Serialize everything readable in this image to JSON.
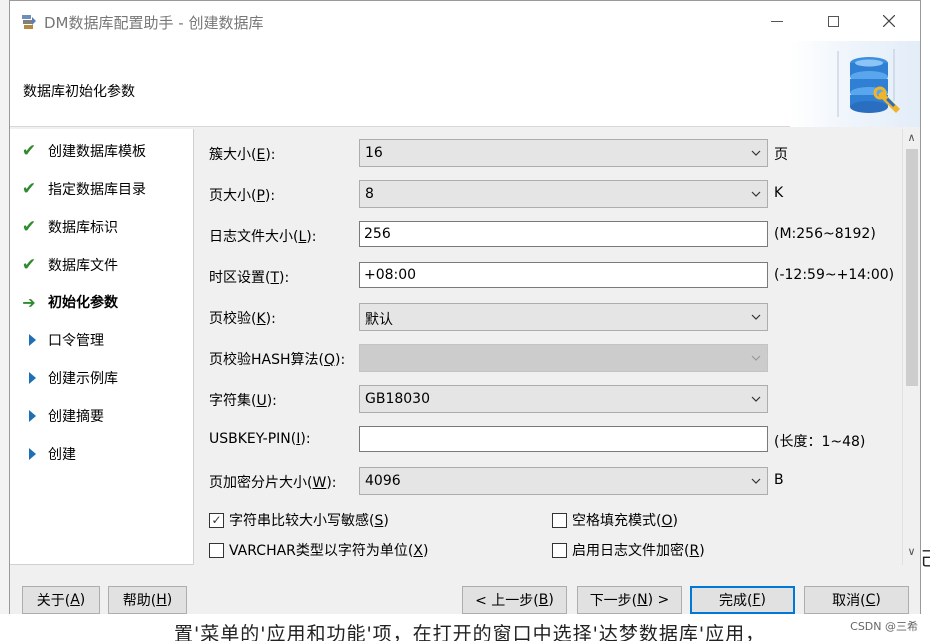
{
  "window": {
    "title": "DM数据库配置助手 - 创建数据库"
  },
  "header": {
    "title": "数据库初始化参数",
    "graphic_icon": "database-config-icon"
  },
  "sidebar": {
    "items": [
      {
        "label": "创建数据库模板",
        "status": "done",
        "icon": "checkmark-icon"
      },
      {
        "label": "指定数据库目录",
        "status": "done",
        "icon": "checkmark-icon"
      },
      {
        "label": "数据库标识",
        "status": "done",
        "icon": "checkmark-icon"
      },
      {
        "label": "数据库文件",
        "status": "done",
        "icon": "checkmark-icon"
      },
      {
        "label": "初始化参数",
        "status": "current",
        "icon": "arrow-right-icon"
      },
      {
        "label": "口令管理",
        "status": "pending",
        "icon": "triangle-right-icon"
      },
      {
        "label": "创建示例库",
        "status": "pending",
        "icon": "triangle-right-icon"
      },
      {
        "label": "创建摘要",
        "status": "pending",
        "icon": "triangle-right-icon"
      },
      {
        "label": "创建",
        "status": "pending",
        "icon": "triangle-right-icon"
      }
    ]
  },
  "form": {
    "extent_size": {
      "label": "簇大小(E):",
      "mnemonic_pre": "簇大小(",
      "mnemonic": "E",
      "mnemonic_post": "):",
      "value": "16",
      "suffix": "页"
    },
    "page_size": {
      "label": "页大小(P):",
      "mnemonic_pre": "页大小(",
      "mnemonic": "P",
      "mnemonic_post": "):",
      "value": "8",
      "suffix": "K"
    },
    "log_size": {
      "label": "日志文件大小(L):",
      "mnemonic_pre": "日志文件大小(",
      "mnemonic": "L",
      "mnemonic_post": "):",
      "value": "256",
      "suffix": "(M:256~8192)"
    },
    "time_zone": {
      "label": "时区设置(T):",
      "mnemonic_pre": "时区设置(",
      "mnemonic": "T",
      "mnemonic_post": "):",
      "value": "+08:00",
      "suffix": "(-12:59~+14:00)"
    },
    "page_check": {
      "label": "页校验(K):",
      "mnemonic_pre": "页校验(",
      "mnemonic": "K",
      "mnemonic_post": "):",
      "value": "默认"
    },
    "page_check_hash": {
      "label": "页校验HASH算法(Q):",
      "mnemonic_pre": "页校验HASH算法(",
      "mnemonic": "Q",
      "mnemonic_post": "):",
      "value": ""
    },
    "charset": {
      "label": "字符集(U):",
      "mnemonic_pre": "字符集(",
      "mnemonic": "U",
      "mnemonic_post": "):",
      "value": "GB18030"
    },
    "usbkey_pin": {
      "label": "USBKEY-PIN(I):",
      "mnemonic_pre": "USBKEY-PIN(",
      "mnemonic": "I",
      "mnemonic_post": "):",
      "value": "",
      "suffix": "(长度：1~48)"
    },
    "page_encrypt": {
      "label": "页加密分片大小(W):",
      "mnemonic_pre": "页加密分片大小(",
      "mnemonic": "W",
      "mnemonic_post": "):",
      "value": "4096",
      "suffix": "B"
    },
    "checks": {
      "case_sensitive": {
        "pre": "字符串比较大小写敏感(",
        "mnemonic": "S",
        "post": ")",
        "checked": true
      },
      "blank_pad": {
        "pre": "空格填充模式(",
        "mnemonic": "O",
        "post": ")",
        "checked": false
      },
      "varchar_char": {
        "pre": "VARCHAR类型以字符为单位(",
        "mnemonic": "X",
        "post": ")",
        "checked": false
      },
      "log_encrypt": {
        "pre": "启用日志文件加密(",
        "mnemonic": "R",
        "post": ")",
        "checked": false
      }
    }
  },
  "footer": {
    "about": {
      "pre": "关于(",
      "mnemonic": "A",
      "post": ")"
    },
    "help": {
      "pre": "帮助(",
      "mnemonic": "H",
      "post": ")"
    },
    "prev": {
      "pre": "< 上一步(",
      "mnemonic": "B",
      "post": ")"
    },
    "next": {
      "pre": "下一步(",
      "mnemonic": "N",
      "post": ") >"
    },
    "finish": {
      "pre": "完成(",
      "mnemonic": "F",
      "post": ")"
    },
    "cancel": {
      "pre": "取消(",
      "mnemonic": "C",
      "post": ")"
    }
  },
  "background": {
    "text": "置'菜单的'应用和功能'项，在打开的窗口中选择'达梦数据库'应用，",
    "right_char": "己",
    "watermark": "CSDN @三希"
  },
  "colors": {
    "check_green": "#2e8b2e",
    "step_blue": "#1f6fb5",
    "primary_border": "#0078d7"
  }
}
